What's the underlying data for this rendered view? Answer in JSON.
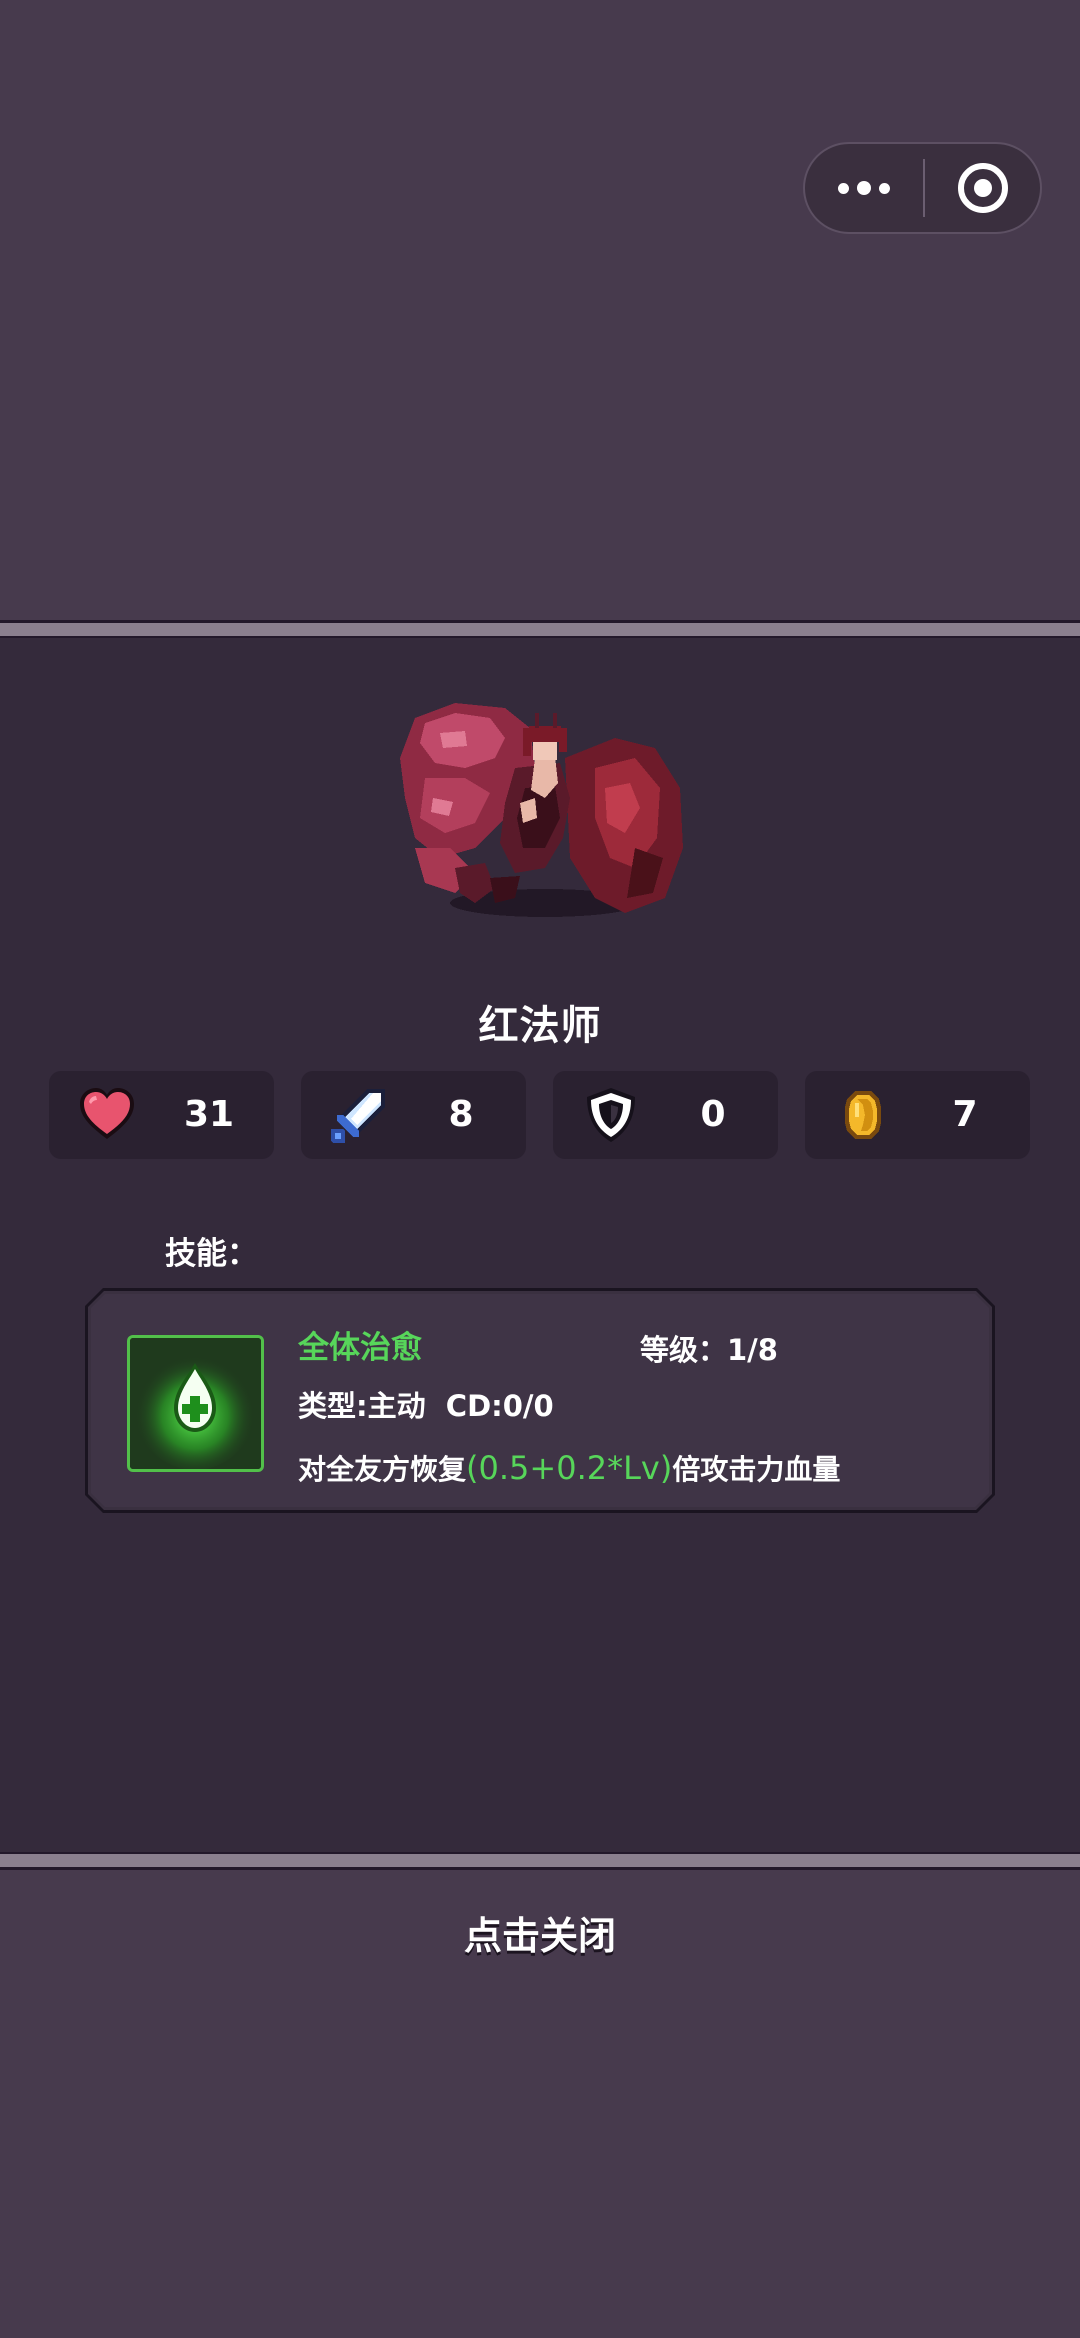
{
  "hero": {
    "name": "红法师"
  },
  "stats": {
    "hp": {
      "icon": "heart-icon",
      "value": "31"
    },
    "attack": {
      "icon": "sword-icon",
      "value": "8"
    },
    "defense": {
      "icon": "shield-icon",
      "value": "0"
    },
    "gold": {
      "icon": "gold-coin-icon",
      "value": "7"
    }
  },
  "skills": {
    "label": "技能：",
    "items": [
      {
        "icon": "healing-drop-icon",
        "name": "全体治愈",
        "level": "等级：1/8",
        "type": "类型:主动  CD:0/0",
        "desc_prefix": "对全友方恢复",
        "desc_formula": "(0.5+0.2*Lv)",
        "desc_suffix": "倍攻击力血量"
      }
    ]
  },
  "footer": {
    "close_label": "点击关闭"
  },
  "colors": {
    "background": "#473a4d",
    "panel": "#342a3b",
    "accent_green": "#57d65a"
  }
}
